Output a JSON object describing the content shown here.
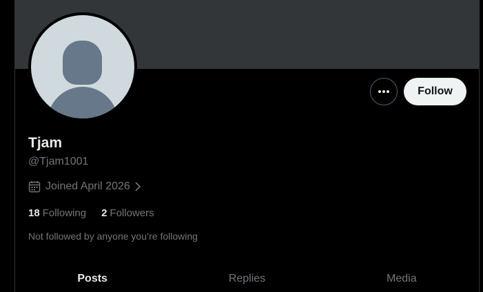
{
  "profile": {
    "display_name": "Tjam",
    "handle": "@Tjam1001",
    "joined": "Joined April 2026",
    "not_followed_text": "Not followed by anyone you’re following"
  },
  "actions": {
    "more_icon": "more-horizontal-icon",
    "follow_label": "Follow"
  },
  "stats": {
    "following_count": "18",
    "following_label": "Following",
    "followers_count": "2",
    "followers_label": "Followers"
  },
  "tabs": [
    {
      "label": "Posts",
      "active": true
    },
    {
      "label": "Replies",
      "active": false
    },
    {
      "label": "Media",
      "active": false
    }
  ],
  "colors": {
    "background": "#000000",
    "banner": "#333639",
    "text_primary": "#e7e9ea",
    "text_secondary": "#71767b",
    "follow_bg": "#eff3f4",
    "avatar_bg": "#cfd9de",
    "avatar_figure": "#66788a"
  }
}
